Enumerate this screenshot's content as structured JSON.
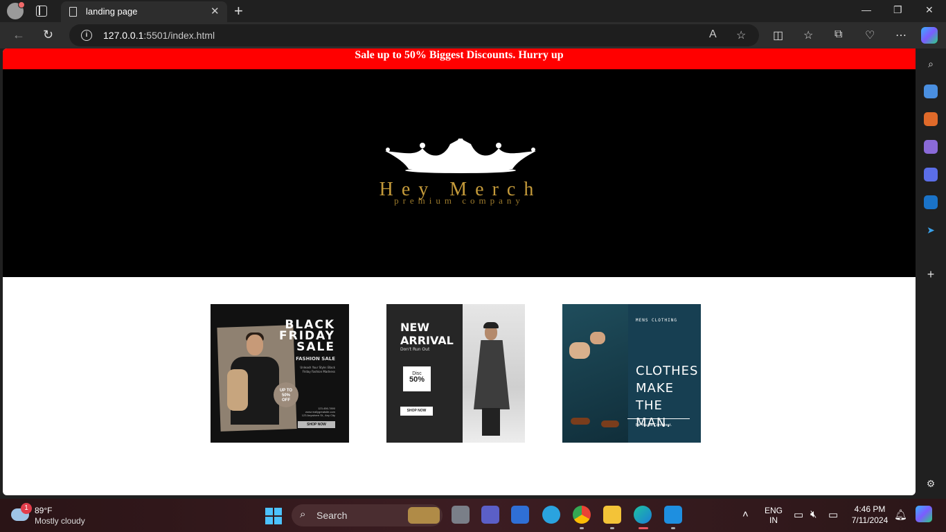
{
  "browser": {
    "tab_title": "landing page",
    "tab_close": "✕",
    "new_tab": "+",
    "url_host": "127.0.0.1",
    "url_rest": ":5501/index.html",
    "info_icon": "i"
  },
  "page": {
    "banner_text": "Sale up to 50% Biggest Discounts. Hurry up",
    "brand_name": "Hey Merch",
    "brand_tagline": "premium company",
    "cards": [
      {
        "title_lines": [
          "BLACK",
          "FRIDAY",
          "SALE"
        ],
        "subtitle": "FASHION SALE",
        "blurb": "Unleash Your Style: Black Friday Fashion Madness",
        "badge_lines": [
          "UP TO",
          "50%",
          "OFF"
        ],
        "contact_lines": [
          "123-456-7890",
          "www.reallygreatsite.com",
          "123 Anywhere St., Any City"
        ],
        "cta": "SHOP NOW"
      },
      {
        "title_lines": [
          "NEW",
          "ARRIVAL"
        ],
        "subtitle": "Don't Run Out",
        "disc_label": "Disc",
        "disc_value": "50%",
        "cta": "SHOP NOW"
      },
      {
        "kicker": "MENS CLOTHING",
        "title_lines": [
          "CLOTHES",
          "MAKE",
          "THE MAN."
        ],
        "tagline": "Be You Be Confident."
      }
    ]
  },
  "taskbar": {
    "weather_badge": "1",
    "temperature": "89°F",
    "condition": "Mostly cloudy",
    "search_label": "Search",
    "lang_1": "ENG",
    "lang_2": "IN",
    "time": "4:46 PM",
    "date": "7/11/2024"
  },
  "colors": {
    "banner": "#ff0000",
    "hero": "#000000",
    "brand_gold": "#c49a3a"
  }
}
